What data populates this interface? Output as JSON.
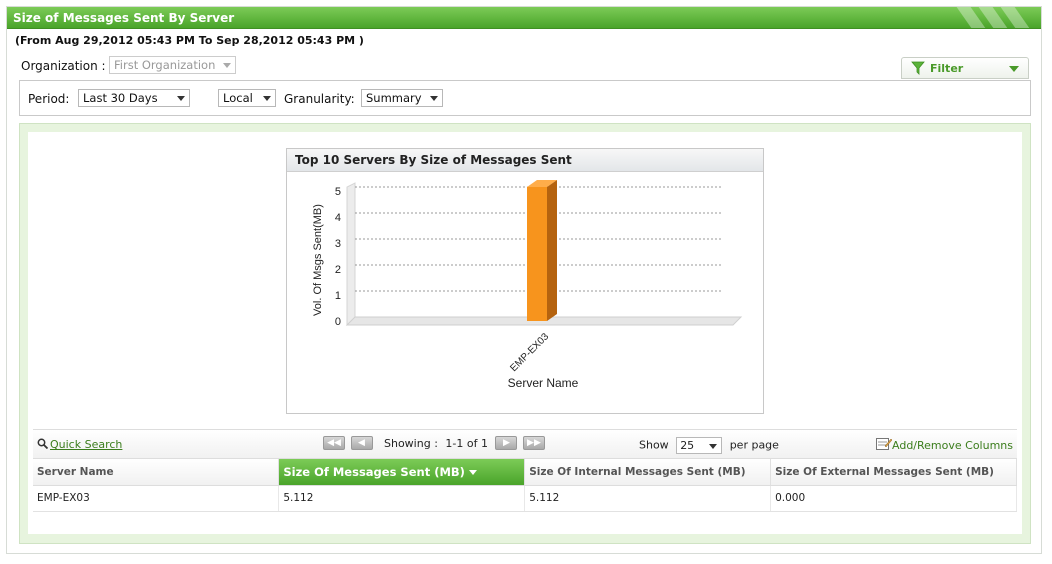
{
  "header": {
    "title": "Size of Messages Sent By Server",
    "date_range": "(From Aug 29,2012 05:43 PM To Sep 28,2012 05:43 PM )"
  },
  "filters": {
    "organization_label": "Organization :",
    "organization_value": "First Organization",
    "filter_button": "Filter",
    "period_label": "Period:",
    "period_value": "Last 30 Days",
    "timezone_value": "Local",
    "granularity_label": "Granularity:",
    "granularity_value": "Summary"
  },
  "chart_data": {
    "type": "bar",
    "title": "Top 10 Servers By Size of Messages Sent",
    "xlabel": "Server Name",
    "ylabel": "Vol. Of Msgs Sent(MB)",
    "categories": [
      "EMP-EX03"
    ],
    "values": [
      5.112
    ],
    "ylim": [
      0,
      5
    ],
    "yticks": [
      0,
      1,
      2,
      3,
      4,
      5
    ],
    "grid": true,
    "bar_color": "#f7941d"
  },
  "grid": {
    "quick_search": "Quick Search",
    "showing_label": "Showing :",
    "showing_value": "1-1 of 1",
    "show_label": "Show",
    "page_size": "25",
    "per_page": "per page",
    "add_remove": "Add/Remove Columns",
    "columns": [
      "Server Name",
      "Size Of Messages Sent (MB)",
      "Size Of Internal Messages Sent (MB)",
      "Size Of External Messages Sent (MB)"
    ],
    "rows": [
      [
        "EMP-EX03",
        "5.112",
        "5.112",
        "0.000"
      ]
    ]
  },
  "colors": {
    "accent": "#4aa42a",
    "link": "#3b7d1c"
  }
}
